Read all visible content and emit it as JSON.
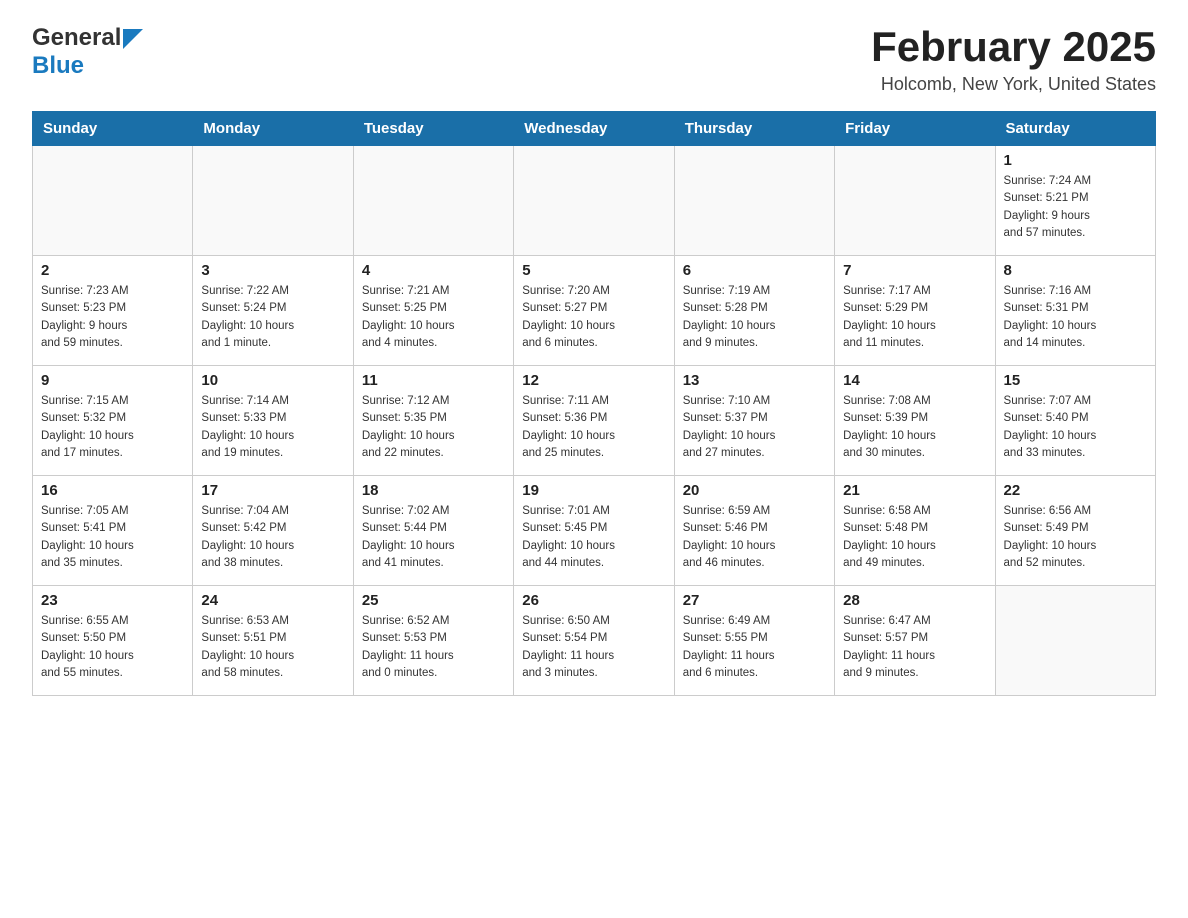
{
  "header": {
    "logo": {
      "general": "General",
      "blue": "Blue"
    },
    "title": "February 2025",
    "location": "Holcomb, New York, United States"
  },
  "weekdays": [
    "Sunday",
    "Monday",
    "Tuesday",
    "Wednesday",
    "Thursday",
    "Friday",
    "Saturday"
  ],
  "weeks": [
    [
      {
        "day": "",
        "info": ""
      },
      {
        "day": "",
        "info": ""
      },
      {
        "day": "",
        "info": ""
      },
      {
        "day": "",
        "info": ""
      },
      {
        "day": "",
        "info": ""
      },
      {
        "day": "",
        "info": ""
      },
      {
        "day": "1",
        "info": "Sunrise: 7:24 AM\nSunset: 5:21 PM\nDaylight: 9 hours\nand 57 minutes."
      }
    ],
    [
      {
        "day": "2",
        "info": "Sunrise: 7:23 AM\nSunset: 5:23 PM\nDaylight: 9 hours\nand 59 minutes."
      },
      {
        "day": "3",
        "info": "Sunrise: 7:22 AM\nSunset: 5:24 PM\nDaylight: 10 hours\nand 1 minute."
      },
      {
        "day": "4",
        "info": "Sunrise: 7:21 AM\nSunset: 5:25 PM\nDaylight: 10 hours\nand 4 minutes."
      },
      {
        "day": "5",
        "info": "Sunrise: 7:20 AM\nSunset: 5:27 PM\nDaylight: 10 hours\nand 6 minutes."
      },
      {
        "day": "6",
        "info": "Sunrise: 7:19 AM\nSunset: 5:28 PM\nDaylight: 10 hours\nand 9 minutes."
      },
      {
        "day": "7",
        "info": "Sunrise: 7:17 AM\nSunset: 5:29 PM\nDaylight: 10 hours\nand 11 minutes."
      },
      {
        "day": "8",
        "info": "Sunrise: 7:16 AM\nSunset: 5:31 PM\nDaylight: 10 hours\nand 14 minutes."
      }
    ],
    [
      {
        "day": "9",
        "info": "Sunrise: 7:15 AM\nSunset: 5:32 PM\nDaylight: 10 hours\nand 17 minutes."
      },
      {
        "day": "10",
        "info": "Sunrise: 7:14 AM\nSunset: 5:33 PM\nDaylight: 10 hours\nand 19 minutes."
      },
      {
        "day": "11",
        "info": "Sunrise: 7:12 AM\nSunset: 5:35 PM\nDaylight: 10 hours\nand 22 minutes."
      },
      {
        "day": "12",
        "info": "Sunrise: 7:11 AM\nSunset: 5:36 PM\nDaylight: 10 hours\nand 25 minutes."
      },
      {
        "day": "13",
        "info": "Sunrise: 7:10 AM\nSunset: 5:37 PM\nDaylight: 10 hours\nand 27 minutes."
      },
      {
        "day": "14",
        "info": "Sunrise: 7:08 AM\nSunset: 5:39 PM\nDaylight: 10 hours\nand 30 minutes."
      },
      {
        "day": "15",
        "info": "Sunrise: 7:07 AM\nSunset: 5:40 PM\nDaylight: 10 hours\nand 33 minutes."
      }
    ],
    [
      {
        "day": "16",
        "info": "Sunrise: 7:05 AM\nSunset: 5:41 PM\nDaylight: 10 hours\nand 35 minutes."
      },
      {
        "day": "17",
        "info": "Sunrise: 7:04 AM\nSunset: 5:42 PM\nDaylight: 10 hours\nand 38 minutes."
      },
      {
        "day": "18",
        "info": "Sunrise: 7:02 AM\nSunset: 5:44 PM\nDaylight: 10 hours\nand 41 minutes."
      },
      {
        "day": "19",
        "info": "Sunrise: 7:01 AM\nSunset: 5:45 PM\nDaylight: 10 hours\nand 44 minutes."
      },
      {
        "day": "20",
        "info": "Sunrise: 6:59 AM\nSunset: 5:46 PM\nDaylight: 10 hours\nand 46 minutes."
      },
      {
        "day": "21",
        "info": "Sunrise: 6:58 AM\nSunset: 5:48 PM\nDaylight: 10 hours\nand 49 minutes."
      },
      {
        "day": "22",
        "info": "Sunrise: 6:56 AM\nSunset: 5:49 PM\nDaylight: 10 hours\nand 52 minutes."
      }
    ],
    [
      {
        "day": "23",
        "info": "Sunrise: 6:55 AM\nSunset: 5:50 PM\nDaylight: 10 hours\nand 55 minutes."
      },
      {
        "day": "24",
        "info": "Sunrise: 6:53 AM\nSunset: 5:51 PM\nDaylight: 10 hours\nand 58 minutes."
      },
      {
        "day": "25",
        "info": "Sunrise: 6:52 AM\nSunset: 5:53 PM\nDaylight: 11 hours\nand 0 minutes."
      },
      {
        "day": "26",
        "info": "Sunrise: 6:50 AM\nSunset: 5:54 PM\nDaylight: 11 hours\nand 3 minutes."
      },
      {
        "day": "27",
        "info": "Sunrise: 6:49 AM\nSunset: 5:55 PM\nDaylight: 11 hours\nand 6 minutes."
      },
      {
        "day": "28",
        "info": "Sunrise: 6:47 AM\nSunset: 5:57 PM\nDaylight: 11 hours\nand 9 minutes."
      },
      {
        "day": "",
        "info": ""
      }
    ]
  ]
}
